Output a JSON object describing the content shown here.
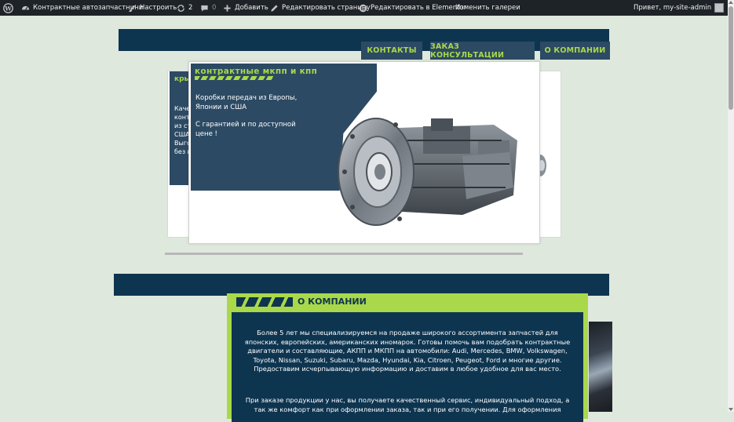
{
  "adminbar": {
    "site_name": "Контрактные автозапчастнини",
    "customize": "Настроить",
    "updates_count": "2",
    "comments_count": "0",
    "add": "Добавить",
    "edit_page": "Редактировать страницу",
    "edit_elementor": "Редактировать в Elementor",
    "edit_gallery": "Изменить галереи",
    "greeting": "Привет, my-site-admin"
  },
  "nav": {
    "items": [
      {
        "label": "КОНТАКТЫ"
      },
      {
        "label": "ЗАКАЗ КОНСУЛЬТАЦИИ"
      },
      {
        "label": "О КОМПАНИИ"
      }
    ]
  },
  "slider": {
    "back_slide": {
      "title": "кры",
      "text": "Каче конт из ст США Выго без п"
    },
    "main_slide": {
      "title": "контрактные мкпп и кпп",
      "line1": "Коробки передач из Европы, Японии и США",
      "line2": "С гарантией и по доступной цене !"
    }
  },
  "about": {
    "heading": "О КОМПАНИИ",
    "paragraph1": "Более 5 лет мы специализируемся на продаже широкого ассортимента запчастей для японских, европейских, американских иномарок. Готовы помочь вам подобрать контрактные двигатели и составляющие, АКПП и МКПП на автомобили: Audi, Mercedes, BMW, Volkswagen, Toyota, Nissan, Suzuki, Subaru, Mazda, Hyundai, Kia, Citroen, Peugeot, Ford и многие другие. Предоставим исчерпывающую информацию и доставим в любое удобное для вас место.",
    "paragraph2": "При заказе продукции у нас, вы получаете качественный сервис, индивидуальный подход, а так же комфорт как при оформлении заказа, так и при его получении. Для оформления"
  },
  "colors": {
    "navy": "#0e3550",
    "panel": "#2c4a63",
    "accent": "#a9d84a",
    "page_bg": "#dfe8dd"
  }
}
